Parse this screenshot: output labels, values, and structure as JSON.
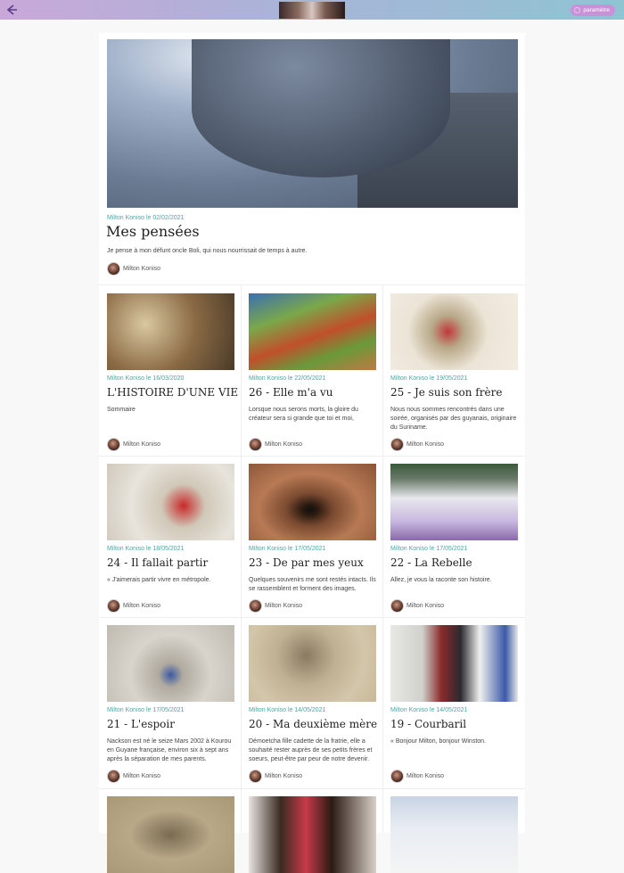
{
  "header": {
    "back_icon": "arrow-left-icon",
    "params_label": "paramètre",
    "params_icon": "gear-icon",
    "accent": "#c892d8"
  },
  "featured": {
    "meta": "Milton Koniso le 02/02/2021",
    "title": "Mes pensées",
    "description": "Je pense à mon défunt oncle Boli, qui nous nourrissait de temps à autre.",
    "author": "Milton Koniso"
  },
  "cards": [
    {
      "meta": "Milton Koniso le 16/03/2020",
      "title": "L'HISTOIRE D'UNE VIE",
      "description": "Sommaire",
      "author": "Milton Koniso"
    },
    {
      "meta": "Milton Koniso le 22/05/2021",
      "title": "26 - Elle m'a vu",
      "description": "Lorsque nous serons morts, la gloire du créateur sera si grande que toi et moi,",
      "author": "Milton Koniso"
    },
    {
      "meta": "Milton Koniso le 19/05/2021",
      "title": "25 - Je suis son frère",
      "description": "Nous nous sommes rencontrés dans une soirée, organisés par des guyanais, originaire du Suriname.",
      "author": "Milton Koniso"
    },
    {
      "meta": "Milton Koniso le 18/05/2021",
      "title": "24 - Il fallait partir",
      "description": "« J'aimerais partir vivre en métropole.",
      "author": "Milton Koniso"
    },
    {
      "meta": "Milton Koniso le 17/05/2021",
      "title": "23 - De par mes yeux",
      "description": "Quelques souvenirs me sont restés intacts. Ils se rassemblent et forment des images.",
      "author": "Milton Koniso"
    },
    {
      "meta": "Milton Koniso le 17/05/2021",
      "title": "22 - La Rebelle",
      "description": "Allez, je vous la raconte son histoire.",
      "author": "Milton Koniso"
    },
    {
      "meta": "Milton Koniso le 17/05/2021",
      "title": "21 - L'espoir",
      "description": "Nackson est né le seize Mars 2002 à Kourou en Guyane française, environ six à sept ans après la séparation de mes parents.",
      "author": "Milton Koniso"
    },
    {
      "meta": "Milton Koniso le 14/05/2021",
      "title": "20 - Ma deuxième mère",
      "description": "Démoetcha fille cadette de la fratrie, elle a souhaité rester auprès de ses petits frères et soeurs, peut-être par peur de notre devenir.",
      "author": "Milton Koniso"
    },
    {
      "meta": "Milton Koniso le 14/05/2021",
      "title": "19 - Courbaril",
      "description": "« Bonjour Milton, bonjour Winston.",
      "author": "Milton Koniso"
    }
  ]
}
